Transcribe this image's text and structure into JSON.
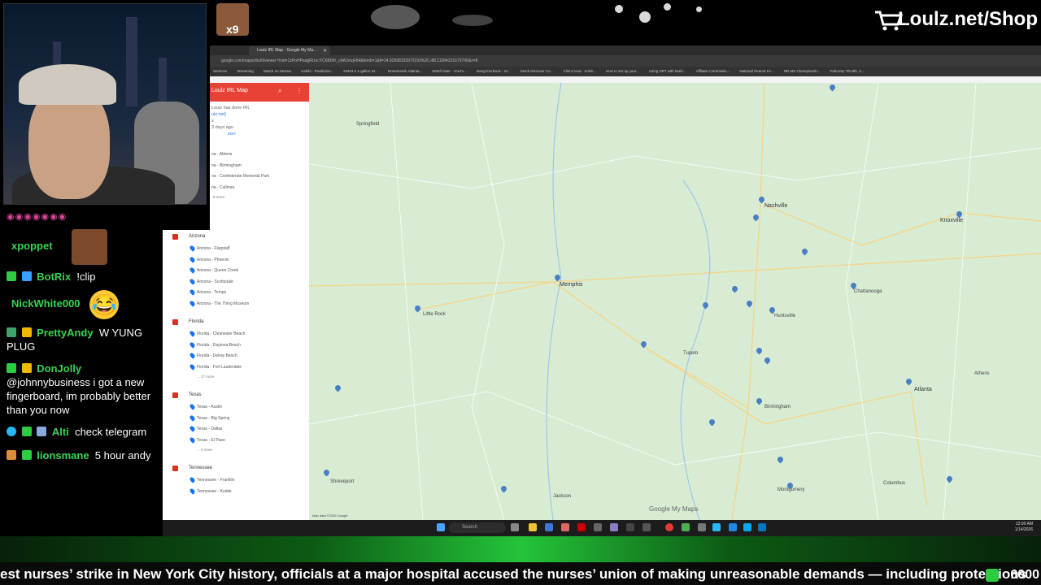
{
  "banner": {
    "shop_label": "Loulz.net/Shop",
    "emote_count": "x9"
  },
  "chat": {
    "badges": "◉◉◉◉◉◉◉",
    "messages": [
      {
        "user": "xpoppet",
        "color": "#39d353",
        "text": ""
      },
      {
        "user": "BotRix",
        "color": "#39d353",
        "text": "!clip"
      },
      {
        "user": "NickWhite000",
        "color": "#39d353",
        "text": ""
      },
      {
        "user": "PrettyAndy",
        "color": "#39d353",
        "text": "W YUNG PLUG"
      },
      {
        "user": "DonJolly",
        "color": "#39d353",
        "text": "@johnnybusiness i got a new fingerboard, im probably better than you now"
      },
      {
        "user": "Alti",
        "color": "#39d353",
        "text": "check telegram"
      },
      {
        "user": "lionsmane",
        "color": "#39d353",
        "text": "5 hour andy"
      }
    ]
  },
  "browser": {
    "tab_title": "Loulz IRL Map - Google My Ma...",
    "url": "google.com/maps/d/u/0/viewer?mid=1zPoHPadgRUocYC6B0tV_o9A2mqF84&femb=1&ll=34.92998333973193%2C-88.11084221679796&z=8",
    "bookmarks": [
      "Services",
      "Streaming",
      "Watch on Stream",
      "Kalshi - Prediction...",
      "KM43-2 1-gallon St...",
      "DreamHack Atlanta...",
      "Watch later - YouTu...",
      "BangYourBuck - St...",
      "Stock Discover Co...",
      "Client Area - AntiS...",
      "How to set up your...",
      "Using SRT with Mobi...",
      "Affiliate Commissio...",
      "National Peanut Fe...",
      "NR MS Championsh...",
      "February 7th-8th, 2..."
    ]
  },
  "map_panel": {
    "title": "Loulz IRL Map",
    "meta_line1": "Loulz has done IRL",
    "meta_line2": "ulz.net)",
    "meta_line3": "s",
    "meta_line4": "3 days ago",
    "edit_label": "EDIT",
    "alabama_places": [
      "na - Athens",
      "na - Birmingham",
      "na - Confederate Memorial Park",
      "na - Cullman"
    ],
    "alabama_more": "9 more",
    "layers": [
      {
        "title": "Arizona",
        "places": [
          "Arizona - Flagstaff",
          "Arizona - Phoenix",
          "Arizona - Queen Creek",
          "Arizona - Scottsdale",
          "Arizona - Tempe",
          "Arizona - The Thing Museum"
        ],
        "more": ""
      },
      {
        "title": "Florida",
        "places": [
          "Florida - Clearwater Beach",
          "Florida - Daytona Beach",
          "Florida - Delray Beach",
          "Florida - Fort Lauderdale"
        ],
        "more": "... 17 more"
      },
      {
        "title": "Texas",
        "places": [
          "Texas - Austin",
          "Texas - Big Spring",
          "Texas - Dallas",
          "Texas - El Paso"
        ],
        "more": "... 4 more"
      },
      {
        "title": "Tennessee",
        "places": [
          "Tennessee - Franklin",
          "Tennessee - Kodak"
        ],
        "more": ""
      }
    ]
  },
  "map": {
    "cities": [
      "Springfield",
      "Nashville",
      "Knoxville",
      "Memphis",
      "Little Rock",
      "Chattanooga",
      "Huntsville",
      "Birmingham",
      "Atlanta",
      "Athens",
      "Montgomery",
      "Columbus",
      "Shreveport",
      "Jackson",
      "Tupelo"
    ],
    "google_label": "Google My Maps",
    "data_label": "Map data ©2026 Google"
  },
  "taskbar": {
    "search_label": "Search",
    "time": "12:00 AM",
    "date": "1/14/2026"
  },
  "ticker": {
    "text": "est nurses’ strike in New York City history, officials at a major hospital accused the nurses’ union of making unreasonable demands — including protections",
    "count": "6000"
  }
}
